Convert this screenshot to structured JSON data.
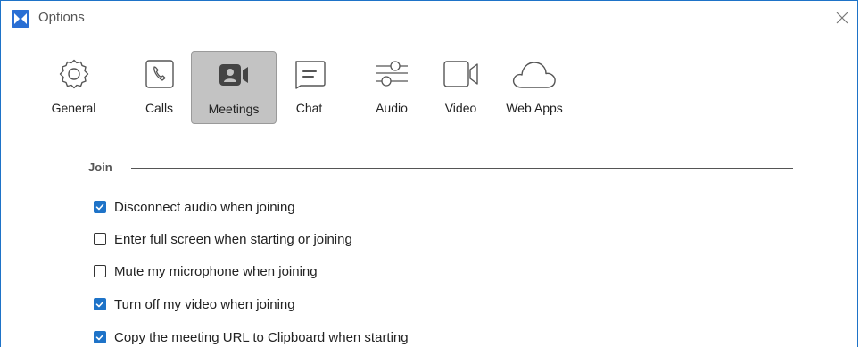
{
  "window": {
    "title": "Options"
  },
  "toolbar": {
    "selected": "Meetings",
    "items": [
      {
        "label": "General",
        "icon": "gear-icon"
      },
      {
        "label": "Calls",
        "icon": "phone-icon"
      },
      {
        "label": "Meetings",
        "icon": "meeting-camera-icon"
      },
      {
        "label": "Chat",
        "icon": "chat-bubble-icon"
      },
      {
        "label": "Audio",
        "icon": "sliders-icon"
      },
      {
        "label": "Video",
        "icon": "video-camera-icon"
      },
      {
        "label": "Web Apps",
        "icon": "cloud-icon"
      }
    ]
  },
  "join": {
    "section_title": "Join",
    "options": [
      {
        "label": "Disconnect audio when joining",
        "checked": true
      },
      {
        "label": "Enter full screen when starting or joining",
        "checked": false
      },
      {
        "label": "Mute my microphone when joining",
        "checked": false
      },
      {
        "label": "Turn off my video when joining",
        "checked": true
      },
      {
        "label": "Copy the meeting URL to Clipboard when starting",
        "checked": true
      }
    ]
  },
  "colors": {
    "accent": "#1e73c8",
    "selected_tab_bg": "#c3c3c3"
  }
}
